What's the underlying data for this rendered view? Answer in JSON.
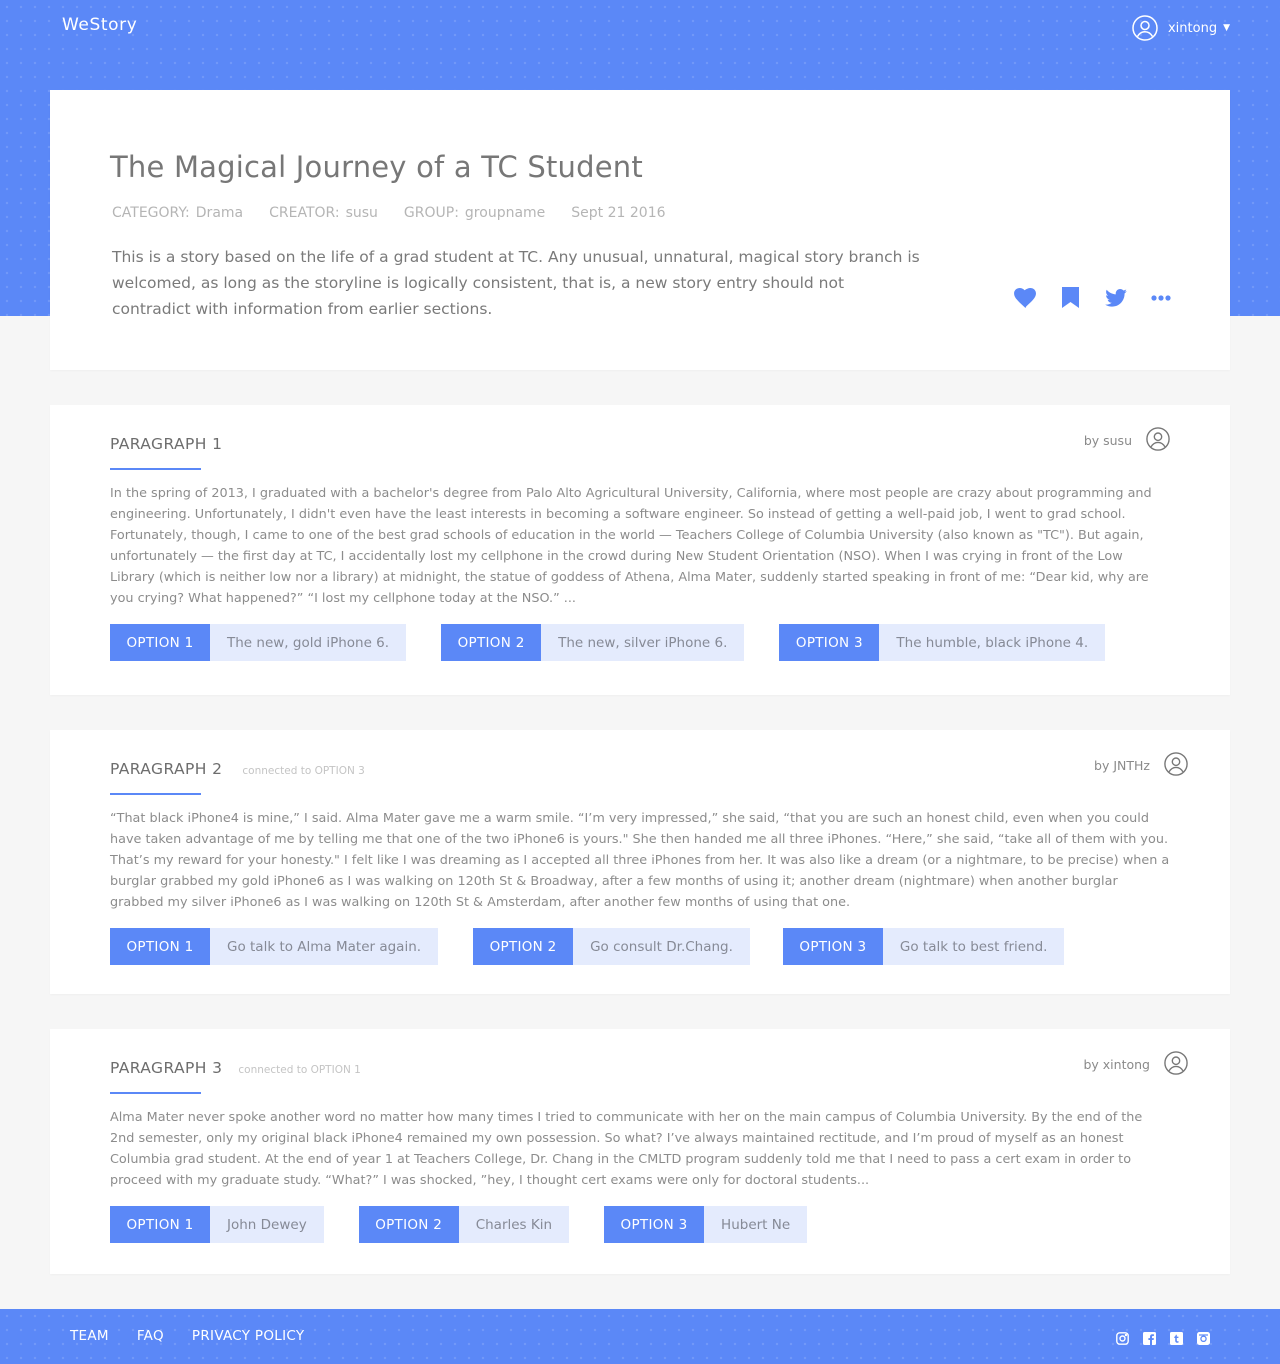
{
  "app": {
    "logo": "WeStory"
  },
  "user": {
    "name": "xintong",
    "menu_icon": "chevron-down-icon"
  },
  "story": {
    "title": "The Magical Journey of a TC Student",
    "meta": {
      "category_label": "CATEGORY:",
      "category": "Drama",
      "creator_label": "CREATOR:",
      "creator": "susu",
      "group_label": "GROUP:",
      "group": "groupname",
      "date": "Sept 21 2016"
    },
    "description": "This is a story based on the life of a grad student at TC. Any unusual, unnatural, magical story branch is welcomed, as long as the storyline is logically consistent, that is, a new story entry should not contradict with information from earlier sections.",
    "actions": [
      "heart-icon",
      "bookmark-icon",
      "twitter-icon",
      "more-icon"
    ]
  },
  "paragraphs": [
    {
      "title": "PARAGRAPH 1",
      "connected": "",
      "author": "by susu",
      "text": "In the spring of 2013, I graduated with a bachelor's degree from Palo Alto Agricultural University, California, where most people are crazy about programming and engineering. Unfortunately, I didn't even have the least interests in becoming a software engineer. So instead of getting a well-paid job, I went to grad school. Fortunately, though, I came to one of the best grad schools of education in the world — Teachers College of Columbia University (also known as \"TC\"). But again, unfortunately — the first day at TC, I accidentally lost my cellphone in the crowd during New Student Orientation (NSO). When I was crying in front of the Low Library (which is neither low nor a library) at midnight, the statue of goddess of Athena, Alma Mater, suddenly started speaking in front of me: “Dear kid, why are you crying? What happened?” “I lost my cellphone today at the NSO.” ...",
      "options": [
        {
          "tag": "OPTION 1",
          "text": "The new, gold iPhone 6."
        },
        {
          "tag": "OPTION 2",
          "text": "The new, silver iPhone 6."
        },
        {
          "tag": "OPTION 3",
          "text": "The humble, black iPhone 4."
        }
      ]
    },
    {
      "title": "PARAGRAPH 2",
      "connected": "connected to OPTION 3",
      "author": "by JNTHz",
      "text": "“That black iPhone4 is mine,” I said. Alma Mater gave me a warm smile. “I’m very impressed,” she said, “that you are such an honest child, even when you could have taken advantage of me by telling me that one of the two iPhone6 is yours.\" She then handed me all three iPhones. “Here,” she said, “take all of them with you. That’s my reward for your honesty.\" I felt like I was dreaming as I accepted all three iPhones from her. It was also like a dream (or a nightmare, to be precise) when a burglar grabbed my gold iPhone6 as I was walking on 120th St & Broadway, after a few months of using it; another dream (nightmare) when another burglar grabbed my silver iPhone6 as I was walking on 120th St & Amsterdam, after another few months of using that one.",
      "options": [
        {
          "tag": "OPTION 1",
          "text": "Go talk to Alma Mater again."
        },
        {
          "tag": "OPTION 2",
          "text": "Go consult Dr.Chang."
        },
        {
          "tag": "OPTION 3",
          "text": "Go talk to best friend."
        }
      ]
    },
    {
      "title": "PARAGRAPH 3",
      "connected": "connected to OPTION 1",
      "author": "by xintong",
      "text": "Alma Mater never spoke another word no matter how many times I tried to communicate with her on the main campus of Columbia University. By the end of the 2nd semester, only my original black iPhone4 remained my own possession. So what? I’ve always maintained rectitude, and I’m proud of myself as an honest Columbia grad student. At the end of year 1 at Teachers College, Dr. Chang in the CMLTD program suddenly told me that I need to pass a cert exam in order to proceed with my graduate study. “What?” I was shocked, ”hey, I thought cert exams were only for doctoral students...",
      "options": [
        {
          "tag": "OPTION 1",
          "text": "John Dewey"
        },
        {
          "tag": "OPTION 2",
          "text": "Charles Kin"
        },
        {
          "tag": "OPTION 3",
          "text": "Hubert Ne"
        }
      ]
    }
  ],
  "footer": {
    "links": [
      "TEAM",
      "FAQ",
      "PRIVACY POLICY"
    ],
    "social": [
      "instagram-icon",
      "facebook-icon",
      "tumblr-icon",
      "camera-icon"
    ]
  },
  "colors": {
    "accent": "#5b88f7",
    "option_bg": "#e4ebfd",
    "page_bg": "#f6f6f6"
  }
}
